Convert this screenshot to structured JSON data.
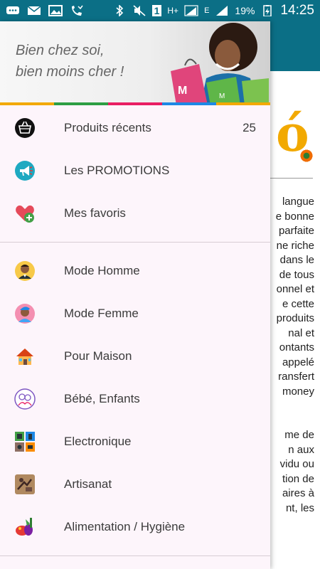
{
  "status_bar": {
    "network_type": "E",
    "hplus": "H+",
    "sim_slot": "1",
    "battery": "19%",
    "time": "14:25"
  },
  "header": {
    "slogan_line1": "Bien chez soi,",
    "slogan_line2": "bien moins cher !"
  },
  "menu_primary": [
    {
      "label": "Produits récents",
      "count": "25",
      "icon": "basket-icon"
    },
    {
      "label": "Les PROMOTIONS",
      "icon": "megaphone-icon"
    },
    {
      "label": "Mes favoris",
      "icon": "heart-plus-icon"
    }
  ],
  "menu_categories": [
    {
      "label": "Mode Homme",
      "icon": "man-avatar-icon"
    },
    {
      "label": "Mode Femme",
      "icon": "woman-avatar-icon"
    },
    {
      "label": "Pour Maison",
      "icon": "house-icon"
    },
    {
      "label": "Bébé, Enfants",
      "icon": "baby-icon"
    },
    {
      "label": "Electronique",
      "icon": "electronics-icon"
    },
    {
      "label": "Artisanat",
      "icon": "craft-icon"
    },
    {
      "label": "Alimentation / Hygiène",
      "icon": "groceries-icon"
    }
  ],
  "background_text": [
    "langue",
    "e bonne",
    "parfaite",
    "ne riche",
    "dans le",
    "de tous",
    "onnel et",
    "e cette",
    "produits",
    "nal et",
    "ontants",
    "appelé",
    "ransfert",
    "money",
    "",
    "",
    "me de",
    "n aux",
    "vidu ou",
    "tion de",
    "aires à",
    "nt, les"
  ],
  "background_logo": "ó"
}
